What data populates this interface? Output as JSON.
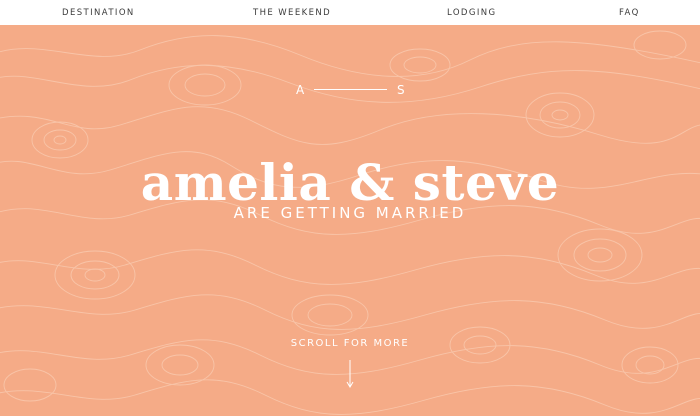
{
  "nav": {
    "destination": "DESTINATION",
    "weekend": "THE WEEKEND",
    "lodging": "LODGING",
    "faq": "FAQ"
  },
  "hero": {
    "monogram_left": "A",
    "monogram_right": "S",
    "names": "amelia & steve",
    "tagline": "ARE GETTING MARRIED",
    "scroll_label": "SCROLL FOR MORE"
  },
  "colors": {
    "background": "#f5ab87",
    "nav_background": "#ffffff",
    "nav_text": "#3b3b3b",
    "hero_text": "#ffffff",
    "topo_lines": "#f9c9ae"
  },
  "icons": {
    "scroll_indicator": "arrow-down-icon",
    "background_pattern": "topographic-pattern"
  }
}
